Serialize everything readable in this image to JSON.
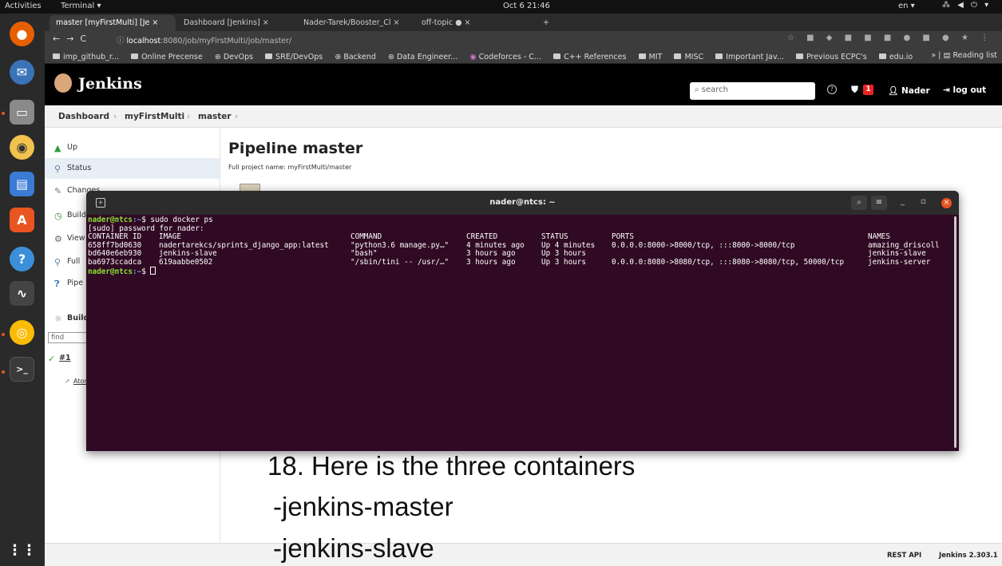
{
  "topbar": {
    "activities": "Activities",
    "terminal_menu": "Terminal ▾",
    "clock": "Oct 6  21:46",
    "lang": "en ▾",
    "sys": "⁂ ◀ ⏻ ▾"
  },
  "browser": {
    "tabs": [
      "master [myFirstMulti] [Je ×",
      "Dashboard [Jenkins]        ×",
      "Nader-Tarek/Booster_Cl ×",
      "off-topic            ● ×",
      "+"
    ],
    "url_host": "localhost",
    "url_rest": ":8080/job/myFirstMulti/job/master/",
    "bookmarks": [
      "imp_github_r...",
      "Online Precense",
      "DevOps",
      "SRE/DevOps",
      "Backend",
      "Data Engineer...",
      "Codeforces - C...",
      "C++ References",
      "MIT",
      "MISC",
      "Important Jav...",
      "Previous ECPC's",
      "edu.io"
    ],
    "reading_list": "Reading list"
  },
  "jenkins": {
    "title": "Jenkins",
    "search_placeholder": "search",
    "badge_count": "1",
    "user": "Nader",
    "logout": "log out",
    "breadcrumb": [
      "Dashboard",
      "myFirstMulti",
      "master"
    ],
    "side_items": [
      "Up",
      "Status",
      "Changes",
      "Build",
      "View",
      "Full",
      "Pipe"
    ],
    "build_history_label": "Build",
    "find_placeholder": "find",
    "build_link": "#1",
    "atom_link": "Atom",
    "page_title": "Pipeline master",
    "full_project_name": "Full project name: myFirstMulti/master",
    "footer_rest": "REST API",
    "footer_version": "Jenkins 2.303.1"
  },
  "terminal": {
    "title": "nader@ntcs: ~",
    "prompt_user": "nader@ntcs",
    "prompt_path": ":~",
    "command": "$ sudo docker ps",
    "sudo_line": "[sudo] password for nader:",
    "headers": [
      "CONTAINER ID",
      "IMAGE",
      "COMMAND",
      "CREATED",
      "STATUS",
      "PORTS",
      "NAMES"
    ],
    "rows": [
      [
        "658ff7bd0630",
        "nadertarekcs/sprints_django_app:latest",
        "\"python3.6 manage.py…\"",
        "4 minutes ago",
        "Up 4 minutes",
        "0.0.0.0:8000->8000/tcp, :::8000->8000/tcp",
        "amazing_driscoll"
      ],
      [
        "bd640e6eb930",
        "jenkins-slave",
        "\"bash\"",
        "3 hours ago",
        "Up 3 hours",
        "",
        "jenkins-slave"
      ],
      [
        "ba6973ccadca",
        "619aabbe0502",
        "\"/sbin/tini -- /usr/…\"",
        "3 hours ago",
        "Up 3 hours",
        "0.0.0.0:8080->8080/tcp, :::8080->8080/tcp, 50000/tcp",
        "jenkins-server"
      ]
    ],
    "last_prompt": "$ "
  },
  "annotation": {
    "line1": "18. Here is the three containers",
    "line2": "-jenkins-master",
    "line3": "-jenkins-slave"
  }
}
